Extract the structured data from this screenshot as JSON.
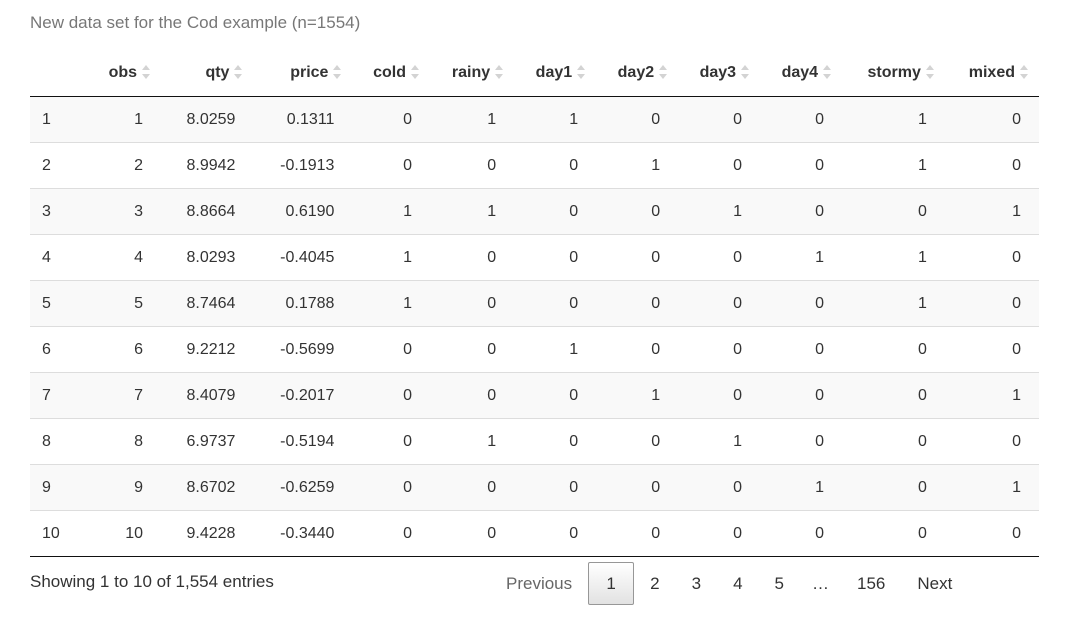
{
  "caption": "New data set for the Cod example (n=1554)",
  "columns": [
    {
      "label": ""
    },
    {
      "label": "obs"
    },
    {
      "label": "qty"
    },
    {
      "label": "price"
    },
    {
      "label": "cold"
    },
    {
      "label": "rainy"
    },
    {
      "label": "day1"
    },
    {
      "label": "day2"
    },
    {
      "label": "day3"
    },
    {
      "label": "day4"
    },
    {
      "label": "stormy"
    },
    {
      "label": "mixed"
    }
  ],
  "rows": [
    [
      "1",
      "1",
      "8.0259",
      "0.1311",
      "0",
      "1",
      "1",
      "0",
      "0",
      "0",
      "1",
      "0"
    ],
    [
      "2",
      "2",
      "8.9942",
      "-0.1913",
      "0",
      "0",
      "0",
      "1",
      "0",
      "0",
      "1",
      "0"
    ],
    [
      "3",
      "3",
      "8.8664",
      "0.6190",
      "1",
      "1",
      "0",
      "0",
      "1",
      "0",
      "0",
      "1"
    ],
    [
      "4",
      "4",
      "8.0293",
      "-0.4045",
      "1",
      "0",
      "0",
      "0",
      "0",
      "1",
      "1",
      "0"
    ],
    [
      "5",
      "5",
      "8.7464",
      "0.1788",
      "1",
      "0",
      "0",
      "0",
      "0",
      "0",
      "1",
      "0"
    ],
    [
      "6",
      "6",
      "9.2212",
      "-0.5699",
      "0",
      "0",
      "1",
      "0",
      "0",
      "0",
      "0",
      "0"
    ],
    [
      "7",
      "7",
      "8.4079",
      "-0.2017",
      "0",
      "0",
      "0",
      "1",
      "0",
      "0",
      "0",
      "1"
    ],
    [
      "8",
      "8",
      "6.9737",
      "-0.5194",
      "0",
      "1",
      "0",
      "0",
      "1",
      "0",
      "0",
      "0"
    ],
    [
      "9",
      "9",
      "8.6702",
      "-0.6259",
      "0",
      "0",
      "0",
      "0",
      "0",
      "1",
      "0",
      "1"
    ],
    [
      "10",
      "10",
      "9.4228",
      "-0.3440",
      "0",
      "0",
      "0",
      "0",
      "0",
      "0",
      "0",
      "0"
    ]
  ],
  "info": "Showing 1 to 10 of 1,554 entries",
  "pagination": {
    "previous": "Previous",
    "pages": [
      "1",
      "2",
      "3",
      "4",
      "5"
    ],
    "ellipsis": "…",
    "last": "156",
    "next": "Next",
    "current": "1"
  },
  "colors": {
    "sort_icon": "#d3d3d3",
    "header_border": "#111111",
    "stripe": "#f9f9f9"
  },
  "icons": {
    "sort": "sort-both-icon"
  }
}
